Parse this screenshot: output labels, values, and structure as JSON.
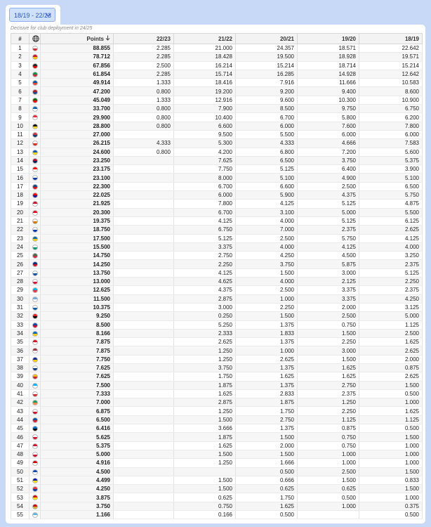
{
  "season_selector": {
    "label": "18/19 - 22/23",
    "icon": "chevron-down-icon"
  },
  "subtitle": "Decisive for club deployment in 24/25",
  "columns": {
    "rank": "#",
    "flag_icon": "globe-icon",
    "points": "Points",
    "sort_icon": "sort-down-icon",
    "s1": "22/23",
    "s2": "21/22",
    "s3": "20/21",
    "s4": "19/20",
    "s5": "18/19"
  },
  "rows": [
    {
      "rank": "1",
      "flag": [
        "#ffffff",
        "#d12b2b"
      ],
      "points": "88.855",
      "s1": "2.285",
      "s2": "21.000",
      "s3": "24.357",
      "s4": "18.571",
      "s5": "22.642"
    },
    {
      "rank": "2",
      "flag": [
        "#c8102e",
        "#f5c400"
      ],
      "points": "78.712",
      "s1": "2.285",
      "s2": "18.428",
      "s3": "19.500",
      "s4": "18.928",
      "s5": "19.571"
    },
    {
      "rank": "3",
      "flag": [
        "#222222",
        "#dd0000"
      ],
      "points": "67.856",
      "s1": "2.500",
      "s2": "16.214",
      "s3": "15.214",
      "s4": "18.714",
      "s5": "15.214"
    },
    {
      "rank": "4",
      "flag": [
        "#009246",
        "#ce2b37"
      ],
      "points": "61.854",
      "s1": "2.285",
      "s2": "15.714",
      "s3": "16.285",
      "s4": "14.928",
      "s5": "12.642"
    },
    {
      "rank": "5",
      "flag": [
        "#0055a4",
        "#ef4135"
      ],
      "points": "49.914",
      "s1": "1.333",
      "s2": "18.416",
      "s3": "7.916",
      "s4": "11.666",
      "s5": "10.583"
    },
    {
      "rank": "6",
      "flag": [
        "#ae1c28",
        "#21468b"
      ],
      "points": "47.200",
      "s1": "0.800",
      "s2": "19.200",
      "s3": "9.200",
      "s4": "9.400",
      "s5": "8.600"
    },
    {
      "rank": "7",
      "flag": [
        "#006600",
        "#ff0000"
      ],
      "points": "45.049",
      "s1": "1.333",
      "s2": "12.916",
      "s3": "9.600",
      "s4": "10.300",
      "s5": "10.900"
    },
    {
      "rank": "8",
      "flag": [
        "#005eb8",
        "#ffffff"
      ],
      "points": "33.700",
      "s1": "0.800",
      "s2": "7.900",
      "s3": "8.500",
      "s4": "9.750",
      "s5": "6.750"
    },
    {
      "rank": "9",
      "flag": [
        "#ed2939",
        "#ffffff"
      ],
      "points": "29.900",
      "s1": "0.800",
      "s2": "10.400",
      "s3": "6.700",
      "s4": "5.800",
      "s5": "6.200"
    },
    {
      "rank": "10",
      "flag": [
        "#000000",
        "#fdda24"
      ],
      "points": "28.800",
      "s1": "0.800",
      "s2": "6.600",
      "s3": "6.000",
      "s4": "7.600",
      "s5": "7.800"
    },
    {
      "rank": "11",
      "flag": [
        "#c6363c",
        "#0c4076"
      ],
      "points": "27.000",
      "s1": "",
      "s2": "9.500",
      "s3": "5.500",
      "s4": "6.000",
      "s5": "6.000"
    },
    {
      "rank": "12",
      "flag": [
        "#ffffff",
        "#d52b1e"
      ],
      "points": "26.215",
      "s1": "4.333",
      "s2": "5.300",
      "s3": "4.333",
      "s4": "4.666",
      "s5": "7.583"
    },
    {
      "rank": "13",
      "flag": [
        "#0057b7",
        "#ffd700"
      ],
      "points": "24.600",
      "s1": "0.800",
      "s2": "4.200",
      "s3": "6.800",
      "s4": "7.200",
      "s5": "5.600"
    },
    {
      "rank": "14",
      "flag": [
        "#ba0c2f",
        "#00205b"
      ],
      "points": "23.250",
      "s1": "",
      "s2": "7.625",
      "s3": "6.500",
      "s4": "3.750",
      "s5": "5.375"
    },
    {
      "rank": "15",
      "flag": [
        "#ff0000",
        "#ffffff"
      ],
      "points": "23.175",
      "s1": "",
      "s2": "7.750",
      "s3": "5.125",
      "s4": "6.400",
      "s5": "3.900"
    },
    {
      "rank": "16",
      "flag": [
        "#ffffff",
        "#0038a8"
      ],
      "points": "23.100",
      "s1": "",
      "s2": "8.000",
      "s3": "5.100",
      "s4": "4.900",
      "s5": "5.100"
    },
    {
      "rank": "17",
      "flag": [
        "#11457e",
        "#d7141a"
      ],
      "points": "22.300",
      "s1": "",
      "s2": "6.700",
      "s3": "6.600",
      "s4": "2.500",
      "s5": "6.500"
    },
    {
      "rank": "18",
      "flag": [
        "#ff0000",
        "#171796"
      ],
      "points": "22.025",
      "s1": "",
      "s2": "6.000",
      "s3": "5.900",
      "s4": "4.375",
      "s5": "5.750"
    },
    {
      "rank": "19",
      "flag": [
        "#c8102e",
        "#ffffff"
      ],
      "points": "21.925",
      "s1": "",
      "s2": "7.800",
      "s3": "4.125",
      "s4": "5.125",
      "s5": "4.875"
    },
    {
      "rank": "20",
      "flag": [
        "#e30a17",
        "#ffffff"
      ],
      "points": "20.300",
      "s1": "",
      "s2": "6.700",
      "s3": "3.100",
      "s4": "5.000",
      "s5": "5.500"
    },
    {
      "rank": "21",
      "flag": [
        "#f4f4e8",
        "#d57800"
      ],
      "points": "19.375",
      "s1": "",
      "s2": "4.125",
      "s3": "4.000",
      "s4": "5.125",
      "s5": "6.125"
    },
    {
      "rank": "22",
      "flag": [
        "#ffffff",
        "#0038b8"
      ],
      "points": "18.750",
      "s1": "",
      "s2": "6.750",
      "s3": "7.000",
      "s4": "2.375",
      "s5": "2.625"
    },
    {
      "rank": "23",
      "flag": [
        "#006aa7",
        "#fecc00"
      ],
      "points": "17.500",
      "s1": "",
      "s2": "5.125",
      "s3": "2.500",
      "s4": "5.750",
      "s5": "4.125"
    },
    {
      "rank": "24",
      "flag": [
        "#ffffff",
        "#00966e"
      ],
      "points": "15.500",
      "s1": "",
      "s2": "3.375",
      "s3": "4.000",
      "s4": "4.125",
      "s5": "4.000"
    },
    {
      "rank": "25",
      "flag": [
        "#436f4d",
        "#cd2a3e"
      ],
      "points": "14.750",
      "s1": "",
      "s2": "2.750",
      "s3": "4.250",
      "s4": "4.500",
      "s5": "3.250"
    },
    {
      "rank": "26",
      "flag": [
        "#002b7f",
        "#ce1126"
      ],
      "points": "14.250",
      "s1": "",
      "s2": "2.250",
      "s3": "3.750",
      "s4": "5.875",
      "s5": "2.375"
    },
    {
      "rank": "27",
      "flag": [
        "#ffffff",
        "#0b4ea2"
      ],
      "points": "13.750",
      "s1": "",
      "s2": "4.125",
      "s3": "1.500",
      "s4": "3.000",
      "s5": "5.125"
    },
    {
      "rank": "28",
      "flag": [
        "#ffffff",
        "#dc143c"
      ],
      "points": "13.000",
      "s1": "",
      "s2": "4.625",
      "s3": "4.000",
      "s4": "2.125",
      "s5": "2.250"
    },
    {
      "rank": "29",
      "flag": [
        "#00b5e2",
        "#ef3340"
      ],
      "points": "12.625",
      "s1": "",
      "s2": "4.375",
      "s3": "2.500",
      "s4": "3.375",
      "s5": "2.375"
    },
    {
      "rank": "30",
      "flag": [
        "#75aadb",
        "#ffffff"
      ],
      "points": "11.500",
      "s1": "",
      "s2": "2.875",
      "s3": "1.000",
      "s4": "3.375",
      "s5": "4.250"
    },
    {
      "rank": "31",
      "flag": [
        "#ffffff",
        "#005da4"
      ],
      "points": "10.375",
      "s1": "",
      "s2": "3.000",
      "s3": "2.250",
      "s4": "2.000",
      "s5": "3.125"
    },
    {
      "rank": "32",
      "flag": [
        "#e41e20",
        "#000000"
      ],
      "points": "9.250",
      "s1": "",
      "s2": "0.250",
      "s3": "1.500",
      "s4": "2.500",
      "s5": "5.000"
    },
    {
      "rank": "33",
      "flag": [
        "#0046ae",
        "#cc092f"
      ],
      "points": "8.500",
      "s1": "",
      "s2": "5.250",
      "s3": "1.375",
      "s4": "0.750",
      "s5": "1.125"
    },
    {
      "rank": "34",
      "flag": [
        "#0065bd",
        "#ffd100"
      ],
      "points": "8.166",
      "s1": "",
      "s2": "2.333",
      "s3": "1.833",
      "s4": "1.500",
      "s5": "2.500"
    },
    {
      "rank": "35",
      "flag": [
        "#d7141a",
        "#ffffff"
      ],
      "points": "7.875",
      "s1": "",
      "s2": "2.625",
      "s3": "1.375",
      "s4": "2.250",
      "s5": "1.625"
    },
    {
      "rank": "36",
      "flag": [
        "#9e3039",
        "#ffffff"
      ],
      "points": "7.875",
      "s1": "",
      "s2": "1.250",
      "s3": "1.000",
      "s4": "3.000",
      "s5": "2.625"
    },
    {
      "rank": "37",
      "flag": [
        "#002395",
        "#fecb00"
      ],
      "points": "7.750",
      "s1": "",
      "s2": "1.250",
      "s3": "2.625",
      "s4": "1.500",
      "s5": "2.000"
    },
    {
      "rank": "38",
      "flag": [
        "#ffffff",
        "#003580"
      ],
      "points": "7.625",
      "s1": "",
      "s2": "3.750",
      "s3": "1.375",
      "s4": "1.625",
      "s5": "0.875"
    },
    {
      "rank": "39",
      "flag": [
        "#fdb913",
        "#c1272d"
      ],
      "points": "7.625",
      "s1": "",
      "s2": "1.750",
      "s3": "1.625",
      "s4": "1.625",
      "s5": "2.625"
    },
    {
      "rank": "40",
      "flag": [
        "#00b2ff",
        "#ffffff"
      ],
      "points": "7.500",
      "s1": "",
      "s2": "1.875",
      "s3": "1.375",
      "s4": "2.750",
      "s5": "1.500"
    },
    {
      "rank": "41",
      "flag": [
        "#ffffff",
        "#d12b2b"
      ],
      "points": "7.333",
      "s1": "",
      "s2": "1.625",
      "s3": "2.833",
      "s4": "2.375",
      "s5": "0.500"
    },
    {
      "rank": "42",
      "flag": [
        "#169b62",
        "#ff883e"
      ],
      "points": "7.000",
      "s1": "",
      "s2": "2.875",
      "s3": "1.875",
      "s4": "1.250",
      "s5": "1.000"
    },
    {
      "rank": "43",
      "flag": [
        "#ffffff",
        "#c8102e"
      ],
      "points": "6.875",
      "s1": "",
      "s2": "1.250",
      "s3": "1.750",
      "s4": "2.250",
      "s5": "1.625"
    },
    {
      "rank": "44",
      "flag": [
        "#02529c",
        "#dc1e35"
      ],
      "points": "6.500",
      "s1": "",
      "s2": "1.500",
      "s3": "2.750",
      "s4": "1.125",
      "s5": "1.125"
    },
    {
      "rank": "45",
      "flag": [
        "#0072ce",
        "#000000"
      ],
      "points": "6.416",
      "s1": "",
      "s2": "3.666",
      "s3": "1.375",
      "s4": "0.875",
      "s5": "0.500"
    },
    {
      "rank": "46",
      "flag": [
        "#ffffff",
        "#cf142b"
      ],
      "points": "5.625",
      "s1": "",
      "s2": "1.875",
      "s3": "1.500",
      "s4": "0.750",
      "s5": "1.500"
    },
    {
      "rank": "47",
      "flag": [
        "#cf142b",
        "#ffffff"
      ],
      "points": "5.375",
      "s1": "",
      "s2": "1.625",
      "s3": "2.000",
      "s4": "0.750",
      "s5": "1.000"
    },
    {
      "rank": "48",
      "flag": [
        "#ffffff",
        "#c8102e"
      ],
      "points": "5.000",
      "s1": "",
      "s2": "1.500",
      "s3": "1.500",
      "s4": "1.000",
      "s5": "1.000"
    },
    {
      "rank": "49",
      "flag": [
        "#cc0000",
        "#ffffff"
      ],
      "points": "4.916",
      "s1": "",
      "s2": "1.250",
      "s3": "1.666",
      "s4": "1.000",
      "s5": "1.000"
    },
    {
      "rank": "50",
      "flag": [
        "#0f47af",
        "#ffffff"
      ],
      "points": "4.500",
      "s1": "",
      "s2": "",
      "s3": "0.500",
      "s4": "2.500",
      "s5": "1.500"
    },
    {
      "rank": "51",
      "flag": [
        "#0018a8",
        "#fedf00"
      ],
      "points": "4.499",
      "s1": "",
      "s2": "1.500",
      "s3": "0.666",
      "s4": "1.500",
      "s5": "0.833"
    },
    {
      "rank": "52",
      "flag": [
        "#ef3340",
        "#003da5"
      ],
      "points": "4.250",
      "s1": "",
      "s2": "1.500",
      "s3": "0.625",
      "s4": "0.625",
      "s5": "1.500"
    },
    {
      "rank": "53",
      "flag": [
        "#d20000",
        "#ffe600"
      ],
      "points": "3.875",
      "s1": "",
      "s2": "0.625",
      "s3": "1.750",
      "s4": "0.500",
      "s5": "1.000"
    },
    {
      "rank": "54",
      "flag": [
        "#c40308",
        "#d4af37"
      ],
      "points": "3.750",
      "s1": "",
      "s2": "0.750",
      "s3": "1.625",
      "s4": "1.000",
      "s5": "0.375"
    },
    {
      "rank": "55",
      "flag": [
        "#5eb6e4",
        "#ffffff"
      ],
      "points": "1.166",
      "s1": "",
      "s2": "0.166",
      "s3": "0.500",
      "s4": "",
      "s5": "0.500"
    }
  ]
}
